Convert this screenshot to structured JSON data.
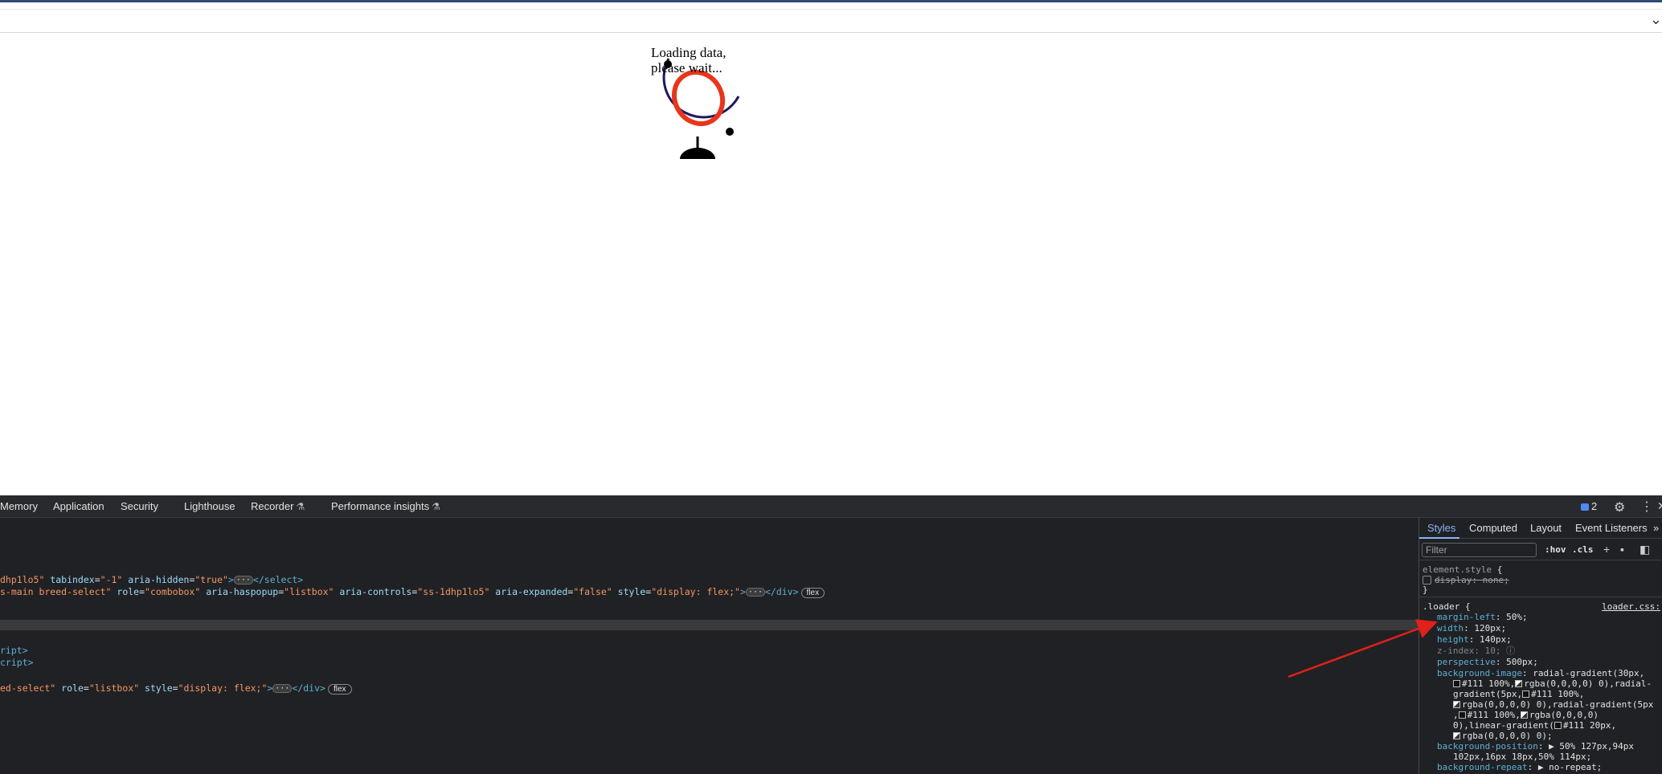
{
  "page": {
    "loader_text_line1": "Loading data,",
    "loader_text_line2": "please wait...",
    "collapse_chevron": "⌄"
  },
  "devtools": {
    "tabs": [
      "Memory",
      "Application",
      "Security",
      "Lighthouse",
      "Recorder",
      "Performance insights"
    ],
    "issues_count": "2",
    "elements": {
      "line1_a": "dhp1lo5\"",
      "line1_attr": " tabindex",
      "line1_eq1": "=",
      "line1_v1": "\"-1\"",
      "line1_attr2": " aria-hidden",
      "line1_v2": "\"true\"",
      "line1_close": "</select>",
      "line2_a": "s-main breed-select\"",
      "line2_role": " role",
      "line2_rolev": "\"combobox\"",
      "line2_haspopup": " aria-haspopup",
      "line2_haspopupv": "\"listbox\"",
      "line2_controls": " aria-controls",
      "line2_controlsv": "\"ss-1dhp1lo5\"",
      "line2_expanded": " aria-expanded",
      "line2_expandedv": "\"false\"",
      "line2_style": " style",
      "line2_stylev": "\"display: flex;\"",
      "line2_close": "</div>",
      "line2_pill": "flex",
      "line3": "ript>",
      "line4": "cript>",
      "line5_a": "ed-select\"",
      "line5_role": " role",
      "line5_rolev": "\"listbox\"",
      "line5_style": " style",
      "line5_stylev": "\"display: flex;\"",
      "line5_close": "</div>",
      "line5_pill": "flex",
      "ellipsis": "···"
    },
    "sidebar": {
      "tabs": [
        "Styles",
        "Computed",
        "Layout",
        "Event Listeners"
      ],
      "more": "»",
      "filter_placeholder": "Filter",
      "hov": ":hov",
      "cls": ".cls",
      "element_style": "element.style",
      "brace_open": "{",
      "brace_close": "}",
      "display_prop": "display",
      "display_val": ": none;",
      "loader_selector": ".loader",
      "loader_source": "loader.css:",
      "margin_left": "margin-left",
      "margin_left_v": ": 50%;",
      "width": "width",
      "width_v": ": 120px;",
      "height": "height",
      "height_v": ": 140px;",
      "z_index": "z-index",
      "z_index_v": ": 10;",
      "perspective": "perspective",
      "perspective_v": ": 500px;",
      "bg_image": "background-image",
      "bg_image_v1": ": radial-gradient(30px,",
      "bg_image_v2": "#111 100%,",
      "bg_image_v2b": "rgba(0,0,0,0) 0),radial-",
      "bg_image_v3": "gradient(5px,",
      "bg_image_v3b": "#111 100%,",
      "bg_image_v4": "rgba(0,0,0,0) 0),radial-gradient(5px",
      "bg_image_v5a": ",",
      "bg_image_v5b": "#111 100%,",
      "bg_image_v5c": "rgba(0,0,0,0)",
      "bg_image_v6": "0),linear-gradient(",
      "bg_image_v6b": "#111 20px,",
      "bg_image_v7": "rgba(0,0,0,0) 0);",
      "bg_position": "background-position",
      "bg_position_v1": ": ▶ 50% 127px,94px",
      "bg_position_v2": "102px,16px 18px,50% 114px;",
      "bg_repeat": "background-repeat",
      "bg_repeat_v": ": ▶ no-repeat;"
    }
  },
  "icons": {
    "gear": "gear-icon",
    "kebab": "kebab-menu-icon",
    "close": "close-icon",
    "flask": "flask-icon",
    "issues": "issues-icon"
  },
  "colors": {
    "arrow": "#e0201b",
    "globe_ring": "#e8361c",
    "globe_arc": "#1b1a5e",
    "devtools_bg": "#202124"
  }
}
